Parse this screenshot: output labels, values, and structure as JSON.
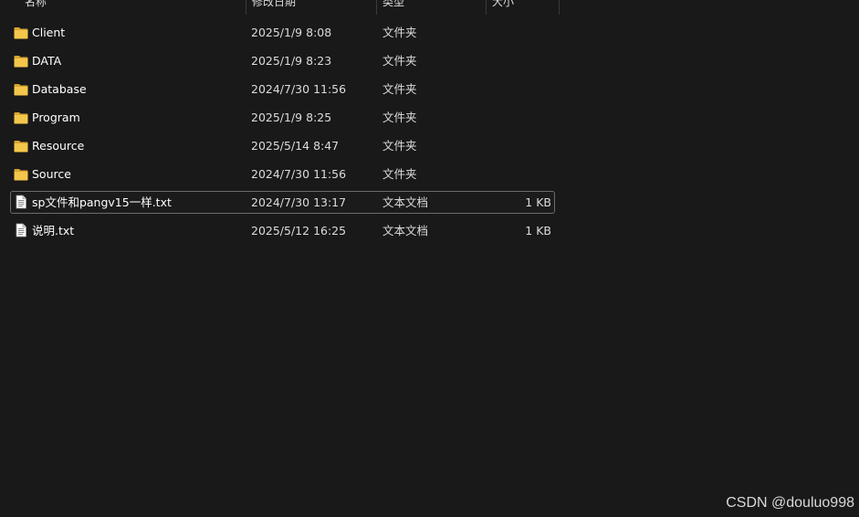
{
  "columns": {
    "name": "名称",
    "date": "修改日期",
    "type": "类型",
    "size": "大小"
  },
  "files": [
    {
      "name": "Client",
      "date": "2025/1/9 8:08",
      "type": "文件夹",
      "size": "",
      "icon": "folder-icon"
    },
    {
      "name": "DATA",
      "date": "2025/1/9 8:23",
      "type": "文件夹",
      "size": "",
      "icon": "folder-icon"
    },
    {
      "name": "Database",
      "date": "2024/7/30 11:56",
      "type": "文件夹",
      "size": "",
      "icon": "folder-icon"
    },
    {
      "name": "Program",
      "date": "2025/1/9 8:25",
      "type": "文件夹",
      "size": "",
      "icon": "folder-icon"
    },
    {
      "name": "Resource",
      "date": "2025/5/14 8:47",
      "type": "文件夹",
      "size": "",
      "icon": "folder-icon"
    },
    {
      "name": "Source",
      "date": "2024/7/30 11:56",
      "type": "文件夹",
      "size": "",
      "icon": "folder-icon"
    },
    {
      "name": "sp文件和pangv15一样.txt",
      "date": "2024/7/30 13:17",
      "type": "文本文档",
      "size": "1 KB",
      "icon": "text-file-icon",
      "selected": true
    },
    {
      "name": "说明.txt",
      "date": "2025/5/12 16:25",
      "type": "文本文档",
      "size": "1 KB",
      "icon": "text-file-icon"
    }
  ],
  "watermark": "CSDN @douluo998",
  "colors": {
    "background": "#191919",
    "folder": "#f4c64b",
    "selection_border": "#6b6b6b"
  }
}
